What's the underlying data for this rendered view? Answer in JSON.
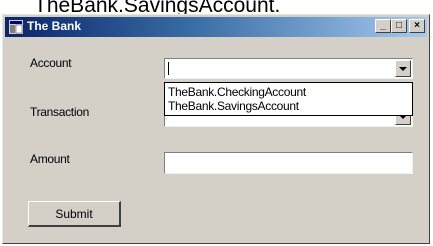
{
  "caption": "TheBank.SavingsAccount.",
  "window": {
    "title": "The Bank",
    "icon": "app-window-icon",
    "controls": {
      "minimize": "_",
      "maximize": "□",
      "close": "×"
    }
  },
  "form": {
    "account_label": "Account",
    "account_value": "",
    "account_options": [
      "TheBank.CheckingAccount",
      "TheBank.SavingsAccount"
    ],
    "transaction_label": "Transaction",
    "amount_label": "Amount",
    "amount_value": "",
    "submit_label": "Submit"
  }
}
